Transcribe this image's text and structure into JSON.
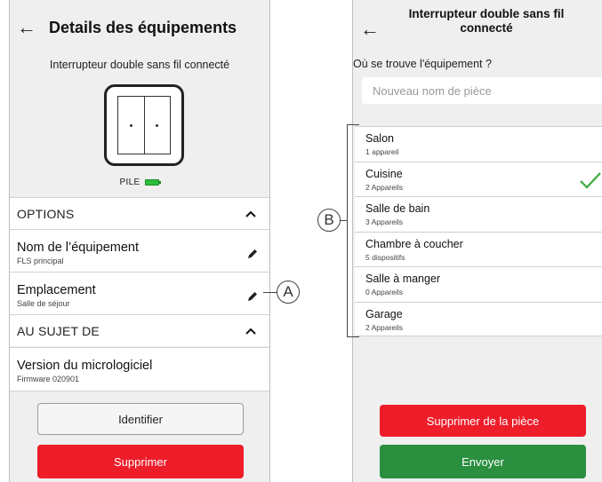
{
  "left_screen": {
    "title": "Details des équipements",
    "subtitle": "Interrupteur double sans fil connecté",
    "battery_label": "PILE",
    "battery_color": "#2dbe3c",
    "options_section": {
      "label": "OPTIONS",
      "items": [
        {
          "main": "Nom de l’équipement",
          "sub": "FLS principal",
          "icon": "pencil-icon"
        },
        {
          "main": "Emplacement",
          "sub": "Salle de séjour",
          "icon": "pencil-icon"
        }
      ]
    },
    "about_section": {
      "label": "AU SUJET DE",
      "items": [
        {
          "main": "Version du micrologiciel",
          "sub": "Firmware 020901"
        }
      ]
    },
    "identify_button": "Identifier",
    "delete_button": "Supprimer"
  },
  "right_screen": {
    "title": "Interrupteur double sans fil connecté",
    "question": "Où se trouve l'équipement ?",
    "room_name_placeholder": "Nouveau nom de pièce",
    "rooms": [
      {
        "name": "Salon",
        "count": "1 appareil",
        "selected": false
      },
      {
        "name": "Cuisine",
        "count": "2 Appareils",
        "selected": true
      },
      {
        "name": "Salle de bain",
        "count": "3 Appareils",
        "selected": false
      },
      {
        "name": "Chambre à coucher",
        "count": "5 dispositifs",
        "selected": false
      },
      {
        "name": "Salle à manger",
        "count": "0 Appareils",
        "selected": false
      },
      {
        "name": "Garage",
        "count": "2 Appareils",
        "selected": false
      }
    ],
    "remove_button": "Supprimer de la pièce",
    "send_button": "Envoyer"
  },
  "callouts": {
    "a": "A",
    "b": "B"
  },
  "colors": {
    "danger": "#ee1d2a",
    "success": "#2a8f3f",
    "check": "#3dab3d"
  }
}
